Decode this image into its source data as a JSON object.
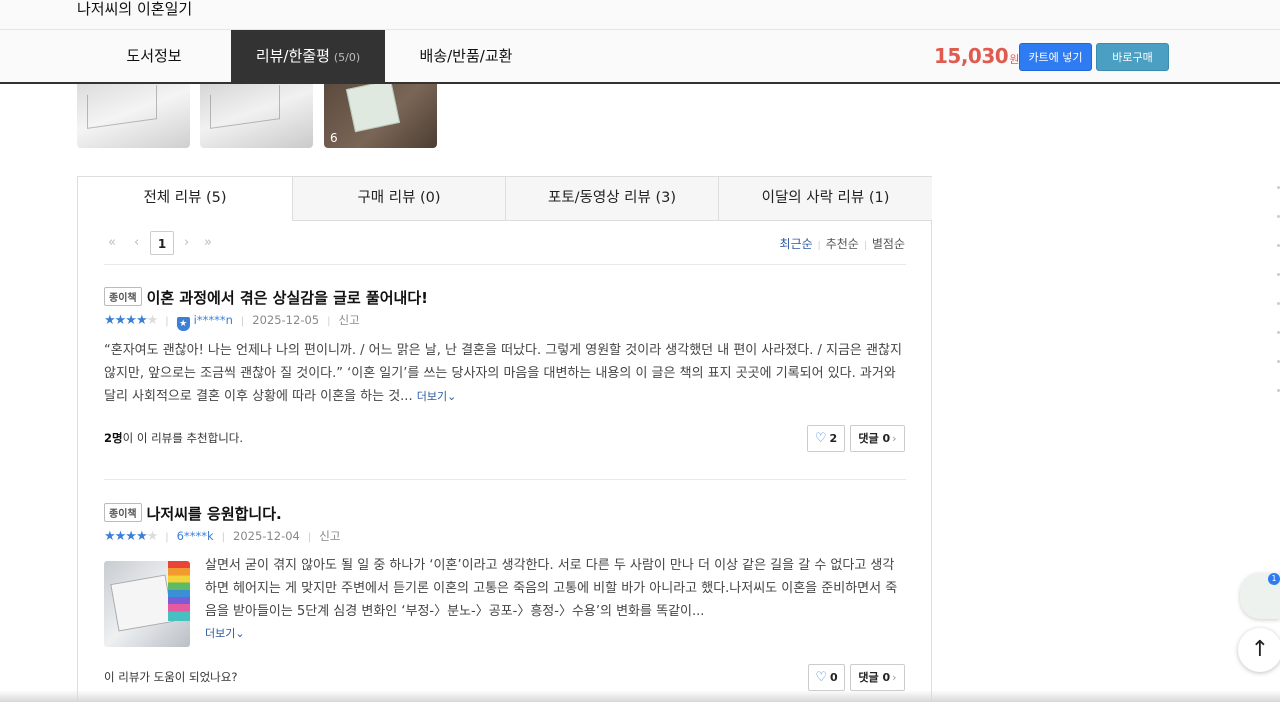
{
  "header": {
    "book_title": "나저씨의 이혼일기"
  },
  "nav": {
    "tabs": [
      {
        "label": "도서정보"
      },
      {
        "label": "리뷰/한줄평",
        "count": "(5/0)"
      },
      {
        "label": "배송/반품/교환"
      }
    ],
    "price": "15,030",
    "price_unit": "원",
    "cart_label": "카트에 넣기",
    "buy_label": "바로구매"
  },
  "thumbnails": {
    "last_count": "6"
  },
  "review_tabs": [
    {
      "label": "전체 리뷰 (5)"
    },
    {
      "label": "구매 리뷰 (0)"
    },
    {
      "label": "포토/동영상 리뷰 (3)"
    },
    {
      "label": "이달의 사락 리뷰 (1)"
    }
  ],
  "pager": {
    "first": "«",
    "prev": "‹",
    "current": "1",
    "next": "›",
    "last": "»"
  },
  "sort": {
    "options": [
      "최근순",
      "추천순",
      "별점순"
    ],
    "active": "최근순"
  },
  "reviews": [
    {
      "badge": "종이책",
      "title": "이혼 과정에서 겪은 상실감을 글로 풀어내다!",
      "rating": 4,
      "user": "i*****n",
      "date": "2025-12-05",
      "report": "신고",
      "body": "“혼자여도 괜찮아! 나는 언제나 나의 편이니까. / 어느 맑은 날, 난 결혼을 떠났다. 그렇게 영원할 것이라 생각했던 내 편이 사라졌다. / 지금은 괜찮지 않지만, 앞으로는 조금씩 괜찮아 질 것이다.” ‘이혼 일기’를 쓰는 당사자의 마음을 대변하는 내용의 이 글은 책의 표지 곳곳에 기록되어 있다. 과거와 달리 사회적으로 결혼 이후 상황에 따라 이혼을 하는 것...",
      "more": "더보기",
      "recommend_count": "2명",
      "recommend_text": "이 이 리뷰를 추천합니다.",
      "likes": "2",
      "comments": "댓글 0"
    },
    {
      "badge": "종이책",
      "title": "나저씨를 응원합니다.",
      "rating": 4,
      "user": "6****k",
      "date": "2025-12-04",
      "report": "신고",
      "body": "살면서 굳이 겪지 않아도 될 일 중 하나가 ‘이혼’이라고 생각한다. 서로 다른 두 사람이 만나 더 이상 같은 길을 갈 수 없다고 생각하면 헤어지는 게 맞지만 주변에서 듣기론 이혼의 고통은 죽음의 고통에 비할 바가 아니라고 했다.나저씨도 이혼을 준비하면서 죽음을 받아들이는 5단계 심경 변화인 ‘부정-〉분노-〉공포-〉흥정-〉수용’의 변화를 똑같이...",
      "more": "더보기",
      "helpful_text": "이 리뷰가 도움이 되었나요?",
      "likes": "0",
      "comments": "댓글 0"
    }
  ],
  "floating": {
    "badge_count": "1",
    "top_arrow": "↑"
  },
  "colors": {
    "price": "#e05a4f",
    "cart": "#2f7cf2",
    "buy": "#4a9fc2",
    "accent_blue": "#3b7fd6",
    "active_tab": "#333333"
  }
}
